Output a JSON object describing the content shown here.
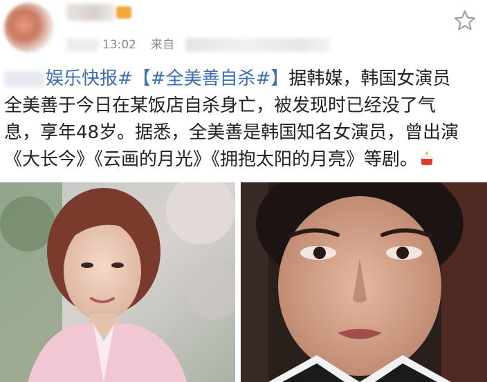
{
  "header": {
    "time": "13:02",
    "source_prefix": "来自",
    "icons": {
      "avatar": "avatar-blurred",
      "vip": "vip-badge",
      "favorite": "star-icon"
    }
  },
  "post": {
    "lines": [
      {
        "prefix": "娱乐快报#",
        "link": "【#全美善自杀#】",
        "rest": "据韩媒，韩国女演员"
      },
      {
        "text": "全美善于今日在某饭店自杀身亡，被发现时已经没了气"
      },
      {
        "text": "息，享年48岁。据悉，全美善是韩国知名女演员，曾出演"
      },
      {
        "text": "《大长今》《云画的月光》《拥抱太阳的月亮》等剧。"
      }
    ],
    "emoji": "candle-emoji"
  },
  "colors": {
    "link": "#3d6fb5",
    "text": "#222222",
    "meta": "#8a8a8a",
    "star": "#9aa0a6"
  },
  "photos": [
    {
      "name": "woman-pink-cardigan-photo"
    },
    {
      "name": "woman-drama-closeup-photo"
    }
  ]
}
